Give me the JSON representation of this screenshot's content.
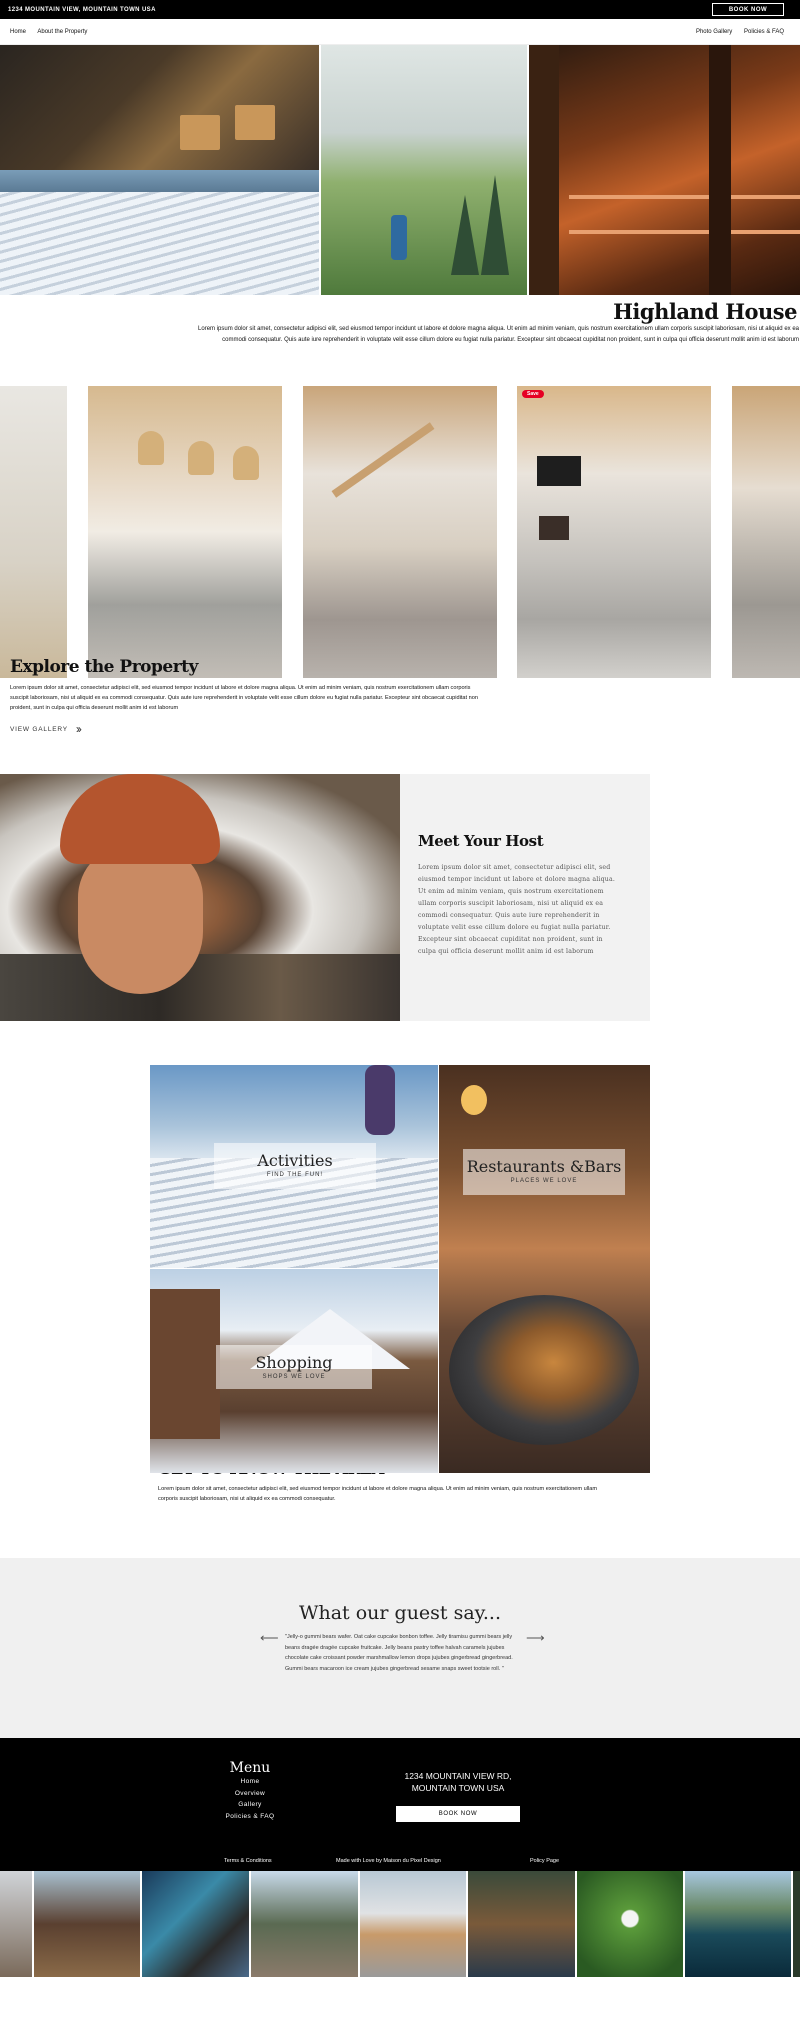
{
  "topbar": {
    "address": "1234 MOUNTAIN VIEW, MOUNTAIN TOWN USA",
    "book_label": "BOOK NOW"
  },
  "nav": {
    "left": [
      "Home",
      "About the Property"
    ],
    "right": [
      "Photo Gallery",
      "Policies & FAQ"
    ]
  },
  "hero": {
    "title": "Highland House",
    "text": "Lorem ipsum dolor sit amet, consectetur adipisci elit, sed eiusmod tempor incidunt ut labore et dolore magna aliqua. Ut enim ad minim veniam, quis nostrum exercitationem ullam corporis suscipit laboriosam, nisi ut aliquid ex ea commodi consequatur. Quis aute iure reprehenderit in voluptate velit esse cillum dolore eu fugiat nulla pariatur. Excepteur sint obcaecat cupiditat non proident, sunt in culpa qui officia deserunt mollit anim id est laborum"
  },
  "gallery": {
    "save_label": "Save"
  },
  "explore": {
    "title": "Explore the Property",
    "text": "Lorem ipsum dolor sit amet, consectetur adipisci elit, sed eiusmod tempor incidunt ut labore et dolore magna aliqua. Ut enim ad minim veniam, quis nostrum exercitationem ullam corporis suscipit laboriosam, nisi ut aliquid ex ea commodi consequatur. Quis aute iure reprehenderit in voluptate velit esse cillum dolore eu fugiat nulla pariatur. Excepteur sint obcaecat cupiditat non proident, sunt in culpa qui officia deserunt mollit anim id est laborum",
    "link_label": "VIEW GALLERY"
  },
  "host": {
    "title": "Meet Your Host",
    "text": "Lorem ipsum dolor sit amet, consectetur adipisci elit, sed eiusmod tempor incidunt ut labore et dolore magna aliqua. Ut enim ad minim veniam, quis nostrum exercitationem ullam corporis suscipit laboriosam, nisi ut aliquid ex ea commodi consequatur. Quis aute iure reprehenderit in voluptate velit esse cillum dolore eu fugiat nulla pariatur. Excepteur sint obcaecat cupiditat non proident, sunt in culpa qui officia deserunt mollit anim id est laborum"
  },
  "area": {
    "tiles": [
      {
        "title": "Activities",
        "subtitle": "FIND THE FUN!"
      },
      {
        "title": "Restaurants &Bars",
        "subtitle": "PLACES WE LOVE"
      },
      {
        "title": "Shopping",
        "subtitle": "SHOPS WE LOVE"
      }
    ],
    "title": "GET TO KNOW THE AREA",
    "text": "Lorem ipsum dolor sit amet, consectetur adipisci elit, sed eiusmod tempor incidunt ut labore et dolore magna aliqua. Ut enim ad minim veniam, quis nostrum exercitationem ullam corporis suscipit laboriosam, nisi ut aliquid ex ea commodi consequatur."
  },
  "guest": {
    "title": "What our guest say...",
    "quote": "\"Jelly-o gummi bears wafer. Oat cake cupcake bonbon toffee. Jelly tiramisu gummi bears jelly beans dragée dragée cupcake fruitcake. Jelly beans pastry toffee halvah caramels jujubes chocolate cake croissant powder marshmallow lemon drops jujubes gingerbread gingerbread. Gummi bears macaroon ice cream jujubes gingerbread sesame snaps sweet tootsie roll. \"",
    "prev_icon": "arrow-left-icon",
    "next_icon": "arrow-right-icon"
  },
  "footer": {
    "menu_title": "Menu",
    "menu_items": [
      "Home",
      "Overview",
      "Gallery",
      "Policies & FAQ"
    ],
    "address_line1": "1234 MOUNTAIN VIEW RD,",
    "address_line2": "MOUNTAIN TOWN USA",
    "book_label": "BOOK NOW",
    "terms": "Terms & Conditions",
    "credit": "Made with Love by Maison du Pixel Design",
    "policy": "Policy Page"
  },
  "colors": {
    "black": "#000000",
    "panel_gray": "#f2f2f2",
    "pinterest_red": "#e60023"
  }
}
